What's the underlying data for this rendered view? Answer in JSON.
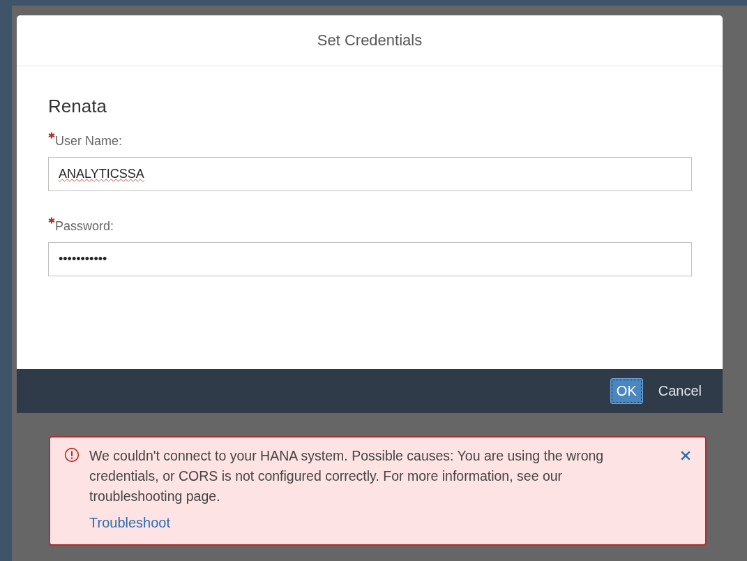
{
  "dialog": {
    "title": "Set Credentials",
    "subtitle": "Renata",
    "fields": [
      {
        "label": "User Name:",
        "required": true,
        "value": "ANALYTICSSA",
        "spellcheck_error": true
      },
      {
        "label": "Password:",
        "required": true,
        "value": "•••••••••••",
        "spellcheck_error": false
      }
    ],
    "buttons": [
      {
        "label": "OK",
        "focused": true
      },
      {
        "label": "Cancel",
        "focused": false
      }
    ]
  },
  "error": {
    "message": "We couldn't connect to your HANA system. Possible causes: You are using the wrong credentials, or CORS is not configured correctly. For more information, see our troubleshooting page.",
    "link": "Troubleshoot"
  }
}
